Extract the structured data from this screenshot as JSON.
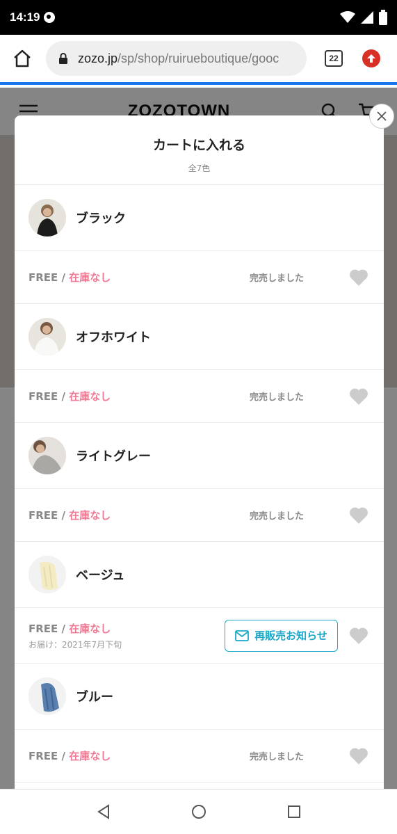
{
  "status_bar": {
    "time": "14:19"
  },
  "browser": {
    "url_domain": "zozo.jp",
    "url_path": "/sp/shop/ruirueboutique/gooc",
    "tab_count": "22"
  },
  "site": {
    "logo": "ZOZOTOWN"
  },
  "modal": {
    "title": "カートに入れる",
    "subtitle": "全7色",
    "colors": [
      {
        "name": "ブラック",
        "size": "FREE",
        "separator": "/",
        "stock": "在庫なし",
        "status": "完売しました"
      },
      {
        "name": "オフホワイト",
        "size": "FREE",
        "separator": "/",
        "stock": "在庫なし",
        "status": "完売しました"
      },
      {
        "name": "ライトグレー",
        "size": "FREE",
        "separator": "/",
        "stock": "在庫なし",
        "status": "完売しました"
      },
      {
        "name": "ベージュ",
        "size": "FREE",
        "separator": "/",
        "stock": "在庫なし",
        "delivery": "お届け：2021年7月下旬",
        "button": "再販売お知らせ"
      },
      {
        "name": "ブルー",
        "size": "FREE",
        "separator": "/",
        "stock": "在庫なし",
        "status": "完売しました"
      }
    ]
  },
  "colors": {
    "accent": "#1aa7c9",
    "stock_pink": "#ef7a94",
    "browser_blue": "#1a73e8",
    "update_red": "#d93025"
  }
}
